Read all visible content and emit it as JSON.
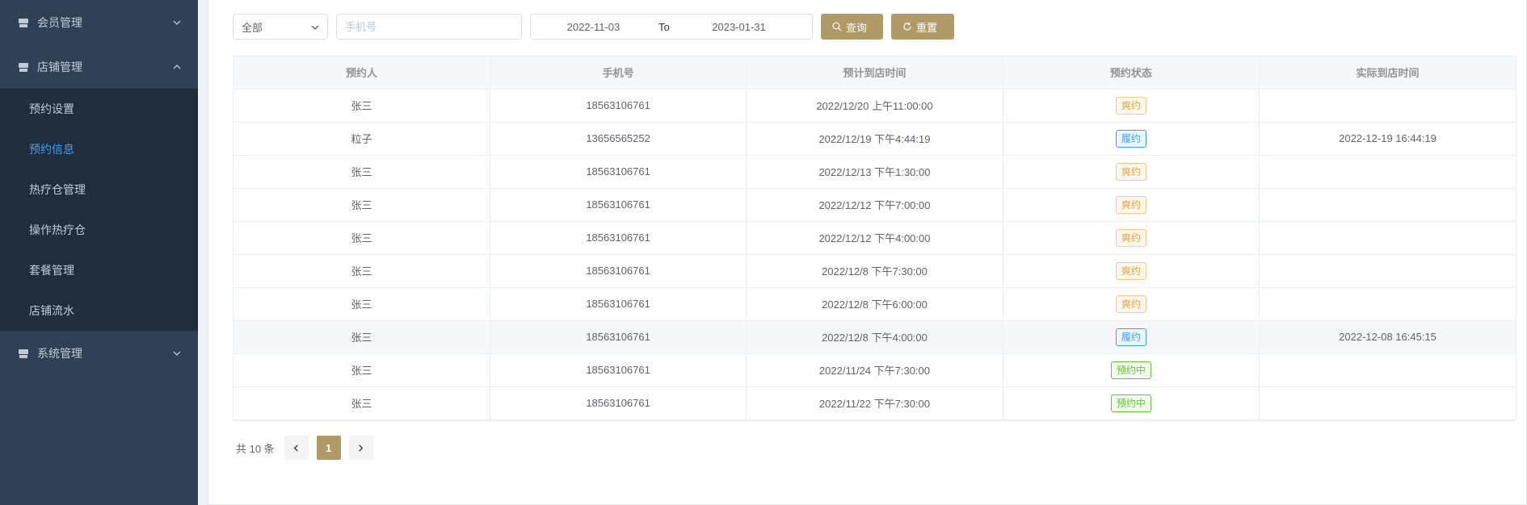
{
  "sidebar": {
    "groups": [
      {
        "label": "会员管理"
      },
      {
        "label": "店铺管理"
      },
      {
        "label": "系统管理"
      }
    ],
    "sub_items": [
      {
        "label": "预约设置"
      },
      {
        "label": "预约信息"
      },
      {
        "label": "热疗仓管理"
      },
      {
        "label": "操作热疗仓"
      },
      {
        "label": "套餐管理"
      },
      {
        "label": "店铺流水"
      }
    ],
    "active_color": "#409eff",
    "bg_color": "#304156"
  },
  "filters": {
    "status_select": "全部",
    "phone_placeholder": "手机号",
    "date_start": "2022-11-03",
    "date_sep": "To",
    "date_end": "2023-01-31",
    "search_label": "查询",
    "reset_label": "重置",
    "button_color": "#b09a67"
  },
  "table": {
    "columns": [
      "预约人",
      "手机号",
      "预计到店时间",
      "预约状态",
      "实际到店时间"
    ],
    "rows": [
      {
        "name": "张三",
        "phone": "18563106761",
        "expected": "2022/12/20 上午11:00:00",
        "status": "爽约",
        "status_type": "warning",
        "actual": ""
      },
      {
        "name": "粒子",
        "phone": "13656565252",
        "expected": "2022/12/19 下午4:44:19",
        "status": "履约",
        "status_type": "primary",
        "actual": "2022-12-19 16:44:19"
      },
      {
        "name": "张三",
        "phone": "18563106761",
        "expected": "2022/12/13 下午1:30:00",
        "status": "爽约",
        "status_type": "warning",
        "actual": ""
      },
      {
        "name": "张三",
        "phone": "18563106761",
        "expected": "2022/12/12 下午7:00:00",
        "status": "爽约",
        "status_type": "warning",
        "actual": ""
      },
      {
        "name": "张三",
        "phone": "18563106761",
        "expected": "2022/12/12 下午4:00:00",
        "status": "爽约",
        "status_type": "warning",
        "actual": ""
      },
      {
        "name": "张三",
        "phone": "18563106761",
        "expected": "2022/12/8 下午7:30:00",
        "status": "爽约",
        "status_type": "warning",
        "actual": ""
      },
      {
        "name": "张三",
        "phone": "18563106761",
        "expected": "2022/12/8 下午6:00:00",
        "status": "爽约",
        "status_type": "warning",
        "actual": ""
      },
      {
        "name": "张三",
        "phone": "18563106761",
        "expected": "2022/12/8 下午4:00:00",
        "status": "履约",
        "status_type": "primary",
        "actual": "2022-12-08 16:45:15"
      },
      {
        "name": "张三",
        "phone": "18563106761",
        "expected": "2022/11/24 下午7:30:00",
        "status": "预约中",
        "status_type": "success",
        "actual": ""
      },
      {
        "name": "张三",
        "phone": "18563106761",
        "expected": "2022/11/22 下午7:30:00",
        "status": "预约中",
        "status_type": "success",
        "actual": ""
      }
    ]
  },
  "pagination": {
    "total_text": "共 10 条",
    "current_page": "1"
  }
}
